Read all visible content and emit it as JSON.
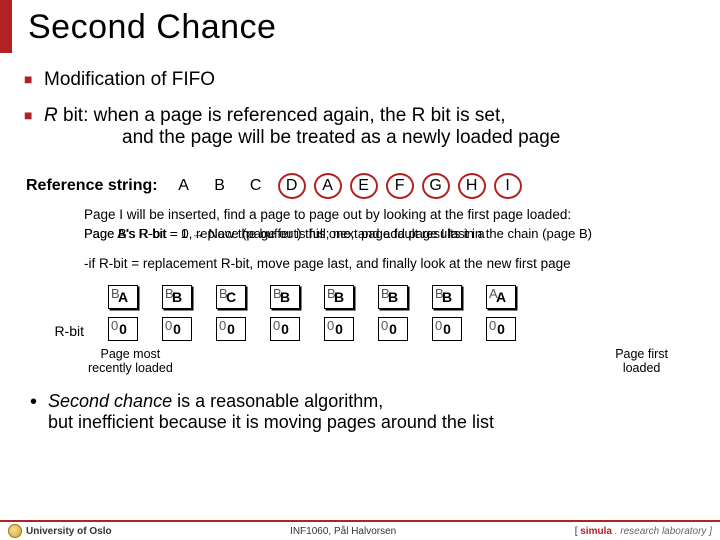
{
  "title": "Second Chance",
  "bullets": {
    "b1": "Modification of FIFO",
    "b2_lead": "R",
    "b2_rest": " bit: when a page is referenced again, the R bit is set,",
    "b2_line2": "and the page will be treated as a newly loaded page"
  },
  "reference": {
    "label": "Reference string:",
    "items": [
      "A",
      "B",
      "C",
      "D",
      "A",
      "E",
      "F",
      "G",
      "H",
      "I"
    ],
    "circled_from_index": 3
  },
  "note": {
    "line1": "Page I will be inserted, find a page to page out by looking at the first page loaded:",
    "overlay1": "Page B's R-bit = 0, replace (page out) this one, and add page I last in the chain (page B)",
    "overlay2": "       Page A's R-bit = 1 → Now the buffer is full; next page fault results in a",
    "line3": "-if R-bit = replacement    R-bit, move page last, and finally look at the new first page"
  },
  "frames": {
    "rbit_label": "R-bit",
    "columns": [
      {
        "top_ghost": "B",
        "top_main": "A",
        "bot_ghost": "0",
        "bot_main": "0"
      },
      {
        "top_ghost": "B",
        "top_main": "B",
        "bot_ghost": "0",
        "bot_main": "0"
      },
      {
        "top_ghost": "B",
        "top_main": "C",
        "bot_ghost": "0",
        "bot_main": "0"
      },
      {
        "top_ghost": "B",
        "top_main": "B",
        "bot_ghost": "0",
        "bot_main": "0"
      },
      {
        "top_ghost": "B",
        "top_main": "B",
        "bot_ghost": "0",
        "bot_main": "0"
      },
      {
        "top_ghost": "B",
        "top_main": "B",
        "bot_ghost": "0",
        "bot_main": "0"
      },
      {
        "top_ghost": "B",
        "top_main": "B",
        "bot_ghost": "0",
        "bot_main": "0"
      },
      {
        "top_ghost": "A",
        "top_main": "A",
        "bot_ghost": "0",
        "bot_main": "0"
      }
    ],
    "left_caption": "Page most\nrecently loaded",
    "right_caption": "Page first\nloaded"
  },
  "final": {
    "lead_italic": "Second chance",
    "rest1": " is a reasonable algorithm,",
    "line2": "but inefficient because it is moving pages around the list"
  },
  "footer": {
    "uio": "University of Oslo",
    "center": "INF1060,  Pål Halvorsen",
    "right_prefix": "[ ",
    "right_brand": "simula",
    "right_suffix": " . research laboratory ]"
  }
}
